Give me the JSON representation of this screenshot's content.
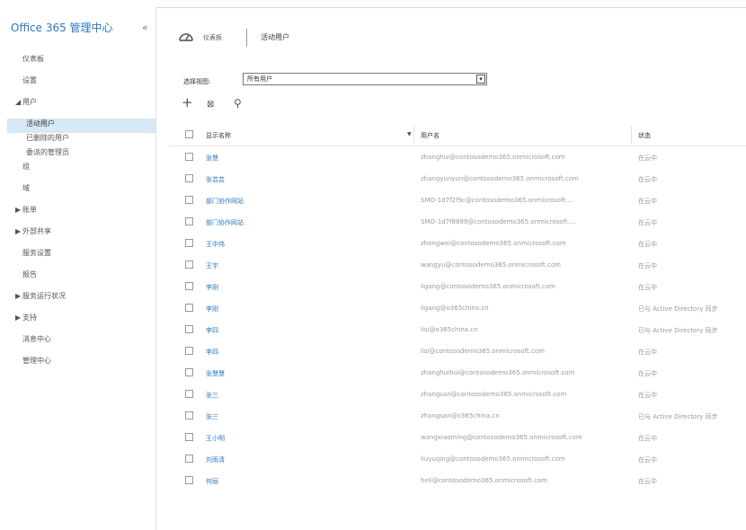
{
  "app": {
    "title": "Office 365 管理中心",
    "collapse_icon": "«"
  },
  "sidebar": {
    "items": [
      {
        "label": "仪表板",
        "level": 0,
        "arrow": ""
      },
      {
        "label": "设置",
        "level": 0,
        "arrow": ""
      },
      {
        "label": "用户",
        "level": 0,
        "arrow": "◢"
      },
      {
        "label": "活动用户",
        "level": 1,
        "arrow": "",
        "selected": true
      },
      {
        "label": "已删除的用户",
        "level": 1,
        "arrow": ""
      },
      {
        "label": "委派的管理员",
        "level": 1,
        "arrow": ""
      },
      {
        "label": "组",
        "level": 0,
        "arrow": ""
      },
      {
        "label": "域",
        "level": 0,
        "arrow": ""
      },
      {
        "label": "账单",
        "level": 0,
        "arrow": "▶"
      },
      {
        "label": "外部共享",
        "level": 0,
        "arrow": "▶"
      },
      {
        "label": "服务设置",
        "level": 0,
        "arrow": ""
      },
      {
        "label": "报告",
        "level": 0,
        "arrow": ""
      },
      {
        "label": "服务运行状况",
        "level": 0,
        "arrow": "▶"
      },
      {
        "label": "支持",
        "level": 0,
        "arrow": "▶"
      },
      {
        "label": "消息中心",
        "level": 0,
        "arrow": ""
      },
      {
        "label": "管理中心",
        "level": 0,
        "arrow": ""
      }
    ]
  },
  "breadcrumb": {
    "home": "仪表板",
    "current": "活动用户"
  },
  "view": {
    "label": "选择视图:",
    "selected": "所有用户"
  },
  "toolbar": {
    "add": "+",
    "edit": "⊠",
    "search": "⚲"
  },
  "table": {
    "columns": {
      "name": "显示名称",
      "user": "用户名",
      "status": "状态",
      "sort": "▼"
    },
    "rows": [
      {
        "name": "张慧",
        "user": "zhanghui@contosodemo365.onmicrosoft.com",
        "status": "在云中"
      },
      {
        "name": "张芸芸",
        "user": "zhangyunyun@contosodemo365.onmicrosoft.com",
        "status": "在云中"
      },
      {
        "name": "部门协作网站",
        "user": "SMO-1d7f2f9c@contosodemo365.onmicrosoft....",
        "status": "在云中"
      },
      {
        "name": "部门协作网站",
        "user": "SMO-1d7f8899@contosodemo365.onmicrosoft....",
        "status": "在云中"
      },
      {
        "name": "王中伟",
        "user": "zhongwei@contosodemo365.onmicrosoft.com",
        "status": "在云中"
      },
      {
        "name": "王宇",
        "user": "wangyu@contosodemo365.onmicrosoft.com",
        "status": "在云中"
      },
      {
        "name": "李刚",
        "user": "ligang@contosodemo365.onmicrosoft.com",
        "status": "在云中"
      },
      {
        "name": "李刚",
        "user": "ligang@o365china.cn",
        "status": "已与 Active Directory 同步"
      },
      {
        "name": "李四",
        "user": "lisi@o365china.cn",
        "status": "已与 Active Directory 同步"
      },
      {
        "name": "李四",
        "user": "lisi@contosodemo365.onmicrosoft.com",
        "status": "在云中"
      },
      {
        "name": "张慧慧",
        "user": "zhanghuihui@contosodemo365.onmicrosoft.com",
        "status": "在云中"
      },
      {
        "name": "张三",
        "user": "zhangsan@contosodemo365.onmicrosoft.com",
        "status": "在云中"
      },
      {
        "name": "张三",
        "user": "zhangsan@o365china.cn",
        "status": "已与 Active Directory 同步"
      },
      {
        "name": "王小明",
        "user": "wangxiaoming@contosodemo365.onmicrosoft.com",
        "status": "在云中"
      },
      {
        "name": "刘雨清",
        "user": "liuyuqing@contosodemo365.onmicrosoft.com",
        "status": "在云中"
      },
      {
        "name": "何丽",
        "user": "heli@contosodemo365.onmicrosoft.com",
        "status": "在云中"
      }
    ]
  },
  "colors": {
    "accent": "#2b79c2",
    "selected_bg": "#d7e8f6"
  }
}
